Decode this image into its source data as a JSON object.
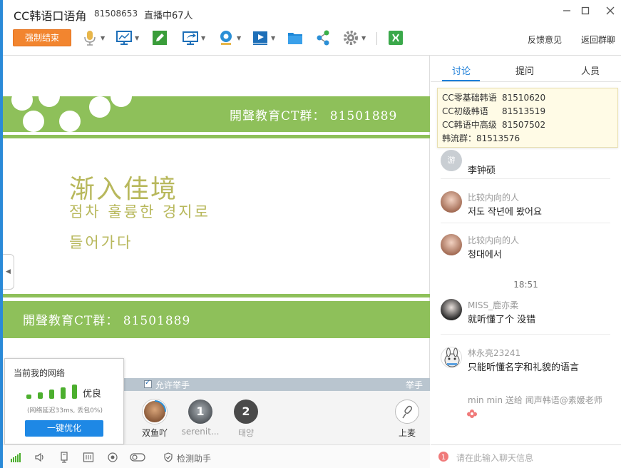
{
  "titlebar": {
    "app_title": "CC韩语口语角",
    "room_id": "81508653",
    "live_count": "直播中67人"
  },
  "toolbar": {
    "end_button": "强制结束",
    "feedback": "反馈意见",
    "back_to_group": "返回群聊",
    "tools": [
      "microphone-icon",
      "screen-share-icon",
      "whiteboard-icon",
      "present-icon",
      "camera-icon",
      "video-play-icon",
      "folder-icon",
      "share-icon",
      "settings-icon",
      "app-icon"
    ]
  },
  "slide": {
    "band_text_top": "開聲教育CT群： 81501889",
    "band_text_bottom": "開聲教育CT群： 81501889",
    "title": "渐入佳境",
    "subtitle_line1": "점차 훌륭한 경지로",
    "subtitle_line2": "들어가다",
    "colors": {
      "band": "#8ec05a",
      "title": "#b8b85c"
    }
  },
  "hand_strip": {
    "allow_label": "允许举手",
    "raise_label": "举手"
  },
  "mic_row": {
    "users": [
      {
        "name": "双鱼吖",
        "seat": ""
      },
      {
        "name": "serenit...",
        "seat": "1"
      },
      {
        "name": "태양",
        "seat": "2"
      }
    ],
    "up_label": "上麦"
  },
  "network": {
    "title": "当前我的网络",
    "grade": "优良",
    "detail": "(网络延迟33ms, 丢包0%)",
    "optimize_button": "一键优化",
    "color": "#4caf2e"
  },
  "statusbar": {
    "helper_label": "检测助手"
  },
  "right_panel": {
    "tabs": [
      "讨论",
      "提问",
      "人员"
    ],
    "notice": [
      {
        "name": "CC零基础韩语",
        "id": "81510620"
      },
      {
        "name": "CC初级韩语",
        "id": "81513519"
      },
      {
        "name": "CC韩语中高级",
        "id": "81507502"
      }
    ],
    "notice_last": "韩流群：81513576",
    "messages": [
      {
        "name": "",
        "avatar_text": "游",
        "text": "李钟硕"
      },
      {
        "name": "比较内向的人",
        "avatar_text": "",
        "text": "저도 작년에 봤어요"
      },
      {
        "name": "比较内向的人",
        "avatar_text": "",
        "text": "청대에서"
      },
      {
        "name": "MISS_鹿亦柔",
        "avatar_text": "",
        "text": "就听懂了个 没错"
      },
      {
        "name": "林永亮23241",
        "avatar_text": "",
        "text": "只能听懂名字和礼貌的语言"
      }
    ],
    "time": "18:51",
    "gift_line": "min min 送给 闻声韩语@素媛老师",
    "input_placeholder": "请在此输入聊天信息"
  }
}
